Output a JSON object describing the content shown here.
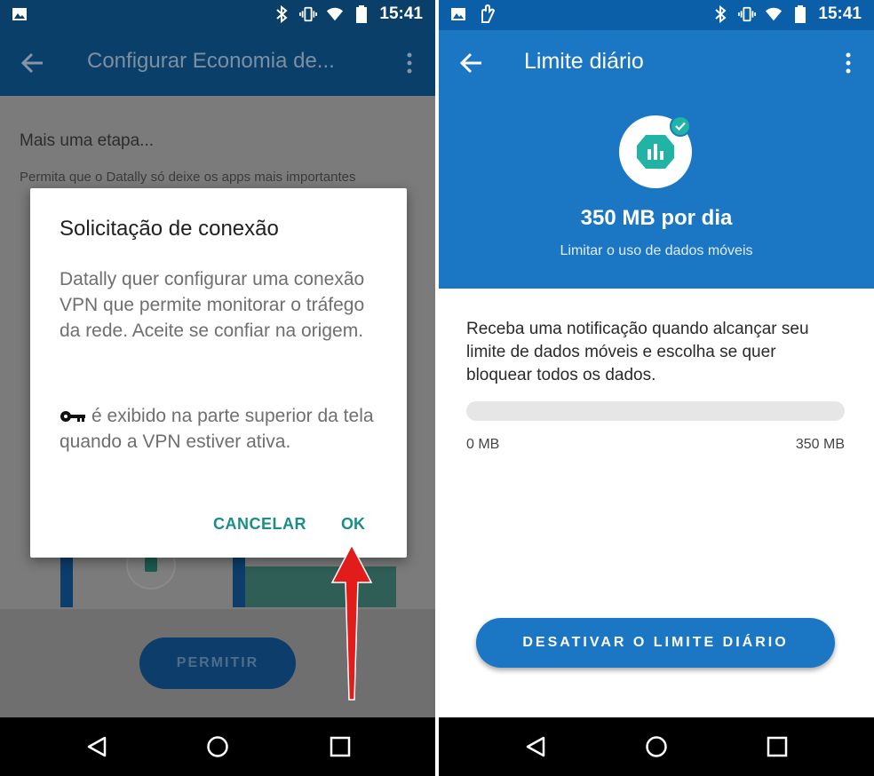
{
  "left_screen": {
    "status_bar": {
      "time": "15:41",
      "icons": [
        "image-icon",
        "bluetooth-icon",
        "vibrate-icon",
        "wifi-icon",
        "battery-icon"
      ]
    },
    "app_bar": {
      "title": "Configurar Economia de..."
    },
    "step": {
      "title": "Mais uma etapa...",
      "description": "Permita que o Datally só deixe os apps mais importantes"
    },
    "permit_button": "PERMITIR",
    "dialog": {
      "title": "Solicitação de conexão",
      "body": "Datally quer configurar uma conexão VPN que permite monitorar o tráfego da rede. Aceite se confiar na origem.",
      "note": "é exibido na parte superior da tela quando a VPN estiver ativa.",
      "cancel_label": "CANCELAR",
      "ok_label": "OK"
    }
  },
  "right_screen": {
    "status_bar": {
      "time": "15:41",
      "icons": [
        "image-icon",
        "hand-icon",
        "bluetooth-icon",
        "vibrate-icon",
        "wifi-icon",
        "battery-icon"
      ]
    },
    "app_bar": {
      "title": "Limite diário"
    },
    "limit_value": "350 MB por dia",
    "limit_subtitle": "Limitar o uso de dados móveis",
    "notify_text": "Receba uma notificação quando alcançar seu limite de dados móveis e escolha se quer bloquear todos os dados.",
    "usage": {
      "fraction": 0,
      "min_label": "0 MB",
      "max_label": "350 MB"
    },
    "disable_button": "DESATIVAR O LIMITE DIÁRIO"
  },
  "colors": {
    "left_app_bar": "#0a3f6a",
    "right_header": "#1b76c4",
    "dialog_accent": "#1a8e84",
    "highlight_arrow": "#e21b1b"
  }
}
